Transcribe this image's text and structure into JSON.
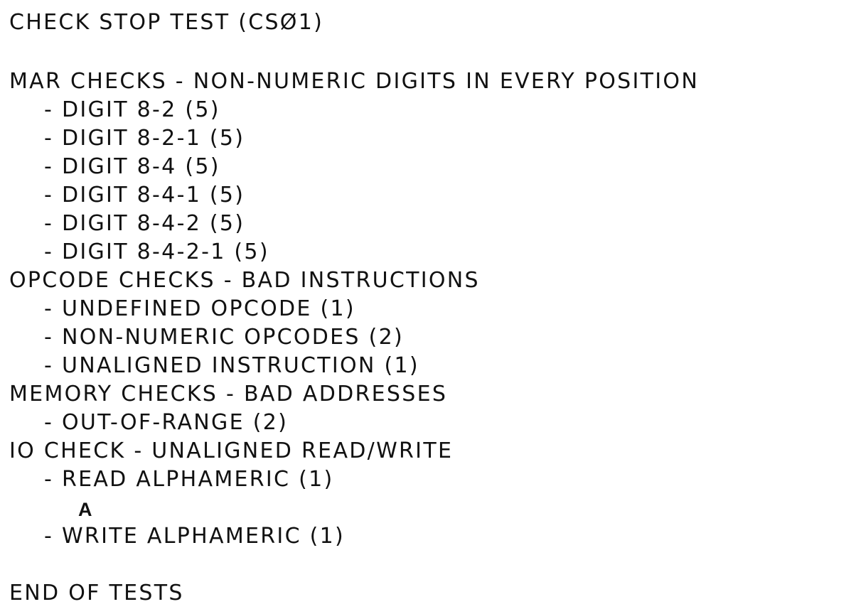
{
  "document": {
    "title": "CHECK STOP TEST (CSØ1)",
    "sections": [
      {
        "heading": "MAR CHECKS - NON-NUMERIC DIGITS IN EVERY POSITION",
        "items": [
          "- DIGIT 8-2 (5)",
          "- DIGIT 8-2-1 (5)",
          "- DIGIT 8-4 (5)",
          "- DIGIT 8-4-1 (5)",
          "- DIGIT 8-4-2 (5)",
          "- DIGIT 8-4-2-1 (5)"
        ]
      },
      {
        "heading": "OPCODE CHECKS - BAD INSTRUCTIONS",
        "items": [
          "- UNDEFINED OPCODE (1)",
          "- NON-NUMERIC OPCODES (2)",
          "- UNALIGNED INSTRUCTION (1)"
        ]
      },
      {
        "heading": "MEMORY CHECKS - BAD ADDRESSES",
        "items": [
          "- OUT-OF-RANGE (2)"
        ]
      },
      {
        "heading": "IO CHECK - UNALIGNED READ/WRITE",
        "items": [
          "- READ ALPHAMERIC (1)",
          "A",
          "- WRITE ALPHAMERIC (1)"
        ]
      }
    ],
    "footer": "END OF TESTS"
  }
}
